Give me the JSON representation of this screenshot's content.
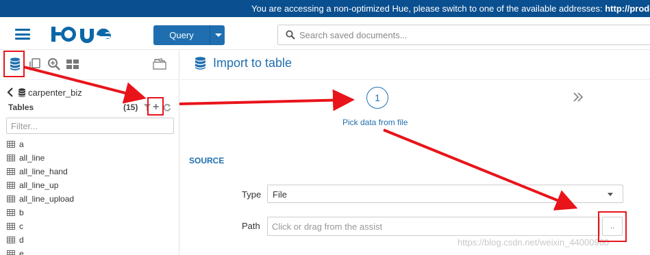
{
  "banner": {
    "message": "You are accessing a non-optimized Hue, please switch to one of the available addresses: ",
    "address": "http://prod-bigd"
  },
  "header": {
    "menu_icon": "hamburger-icon",
    "logo_text": "HUE",
    "query_button": "Query",
    "search_placeholder": "Search saved documents..."
  },
  "assist": {
    "icons": [
      "database-icon",
      "documents-icon",
      "search-icon",
      "grid-icon",
      "folder-icon"
    ],
    "database": "carpenter_biz",
    "tables_label": "Tables",
    "tables_count": "(15)",
    "filter_placeholder": "Filter...",
    "tables": [
      "a",
      "all_line",
      "all_line_hand",
      "all_line_up",
      "all_line_upload",
      "b",
      "c",
      "d",
      "e"
    ]
  },
  "main": {
    "title": "Import to table",
    "step_number": "1",
    "step_label": "Pick data from file",
    "section": "SOURCE",
    "type_label": "Type",
    "type_value": "File",
    "path_label": "Path",
    "path_placeholder": "Click or drag from the assist",
    "browse_button": ".."
  },
  "watermark": "https://blog.csdn.net/weixin_44000960",
  "colors": {
    "banner": "#0a4f8f",
    "accent": "#1f6fb0",
    "annotation": "#e8141a"
  }
}
